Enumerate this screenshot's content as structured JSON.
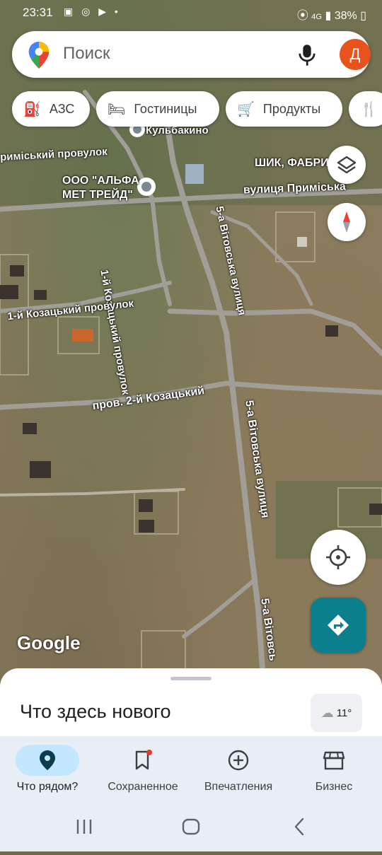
{
  "status": {
    "time": "23:31",
    "signal": "4G",
    "battery": "38%"
  },
  "search": {
    "placeholder": "Поиск",
    "avatar_letter": "Д"
  },
  "chips": [
    {
      "label": "АЗС",
      "icon": "gas-station-icon"
    },
    {
      "label": "Гостиницы",
      "icon": "bed-icon"
    },
    {
      "label": "Продукты",
      "icon": "cart-icon"
    },
    {
      "label": "",
      "icon": "restaurant-icon"
    }
  ],
  "map_labels": {
    "kulbakino": "Кульбакино",
    "primiskyi_provulok": "риміський провулок",
    "alfa_met": "ООО \"АЛЬФА\nМЕТ ТРЕЙД\"",
    "shik": "ШИК, ФАБРИ",
    "vulytsia_primiska": "вулиця Приміська",
    "kozatskyi_1_vert": "1-й Козацький провулок",
    "vitovska_5_top": "5-а Вітовська вулиця",
    "kozatskyi_1_horiz": "1-й Козацький провулок",
    "kozatskyi_2": "пров. 2-й Козацький",
    "vitovska_5_mid": "5-а Вітовська вулиця",
    "vitovska_5_bottom": "5-а Вітовсь"
  },
  "google_logo": "Google",
  "sheet": {
    "title": "Что здесь нового",
    "weather": "11°"
  },
  "nav": [
    {
      "label": "Что рядом?",
      "icon": "location-pin-icon",
      "active": true
    },
    {
      "label": "Сохраненное",
      "icon": "bookmark-icon",
      "active": false
    },
    {
      "label": "Впечатления",
      "icon": "add-circle-icon",
      "active": false
    },
    {
      "label": "Бизнес",
      "icon": "storefront-icon",
      "active": false
    }
  ],
  "colors": {
    "accent_orange": "#e8521c",
    "directions_teal": "#0b7f8e",
    "nav_active": "#c2e7ff"
  }
}
